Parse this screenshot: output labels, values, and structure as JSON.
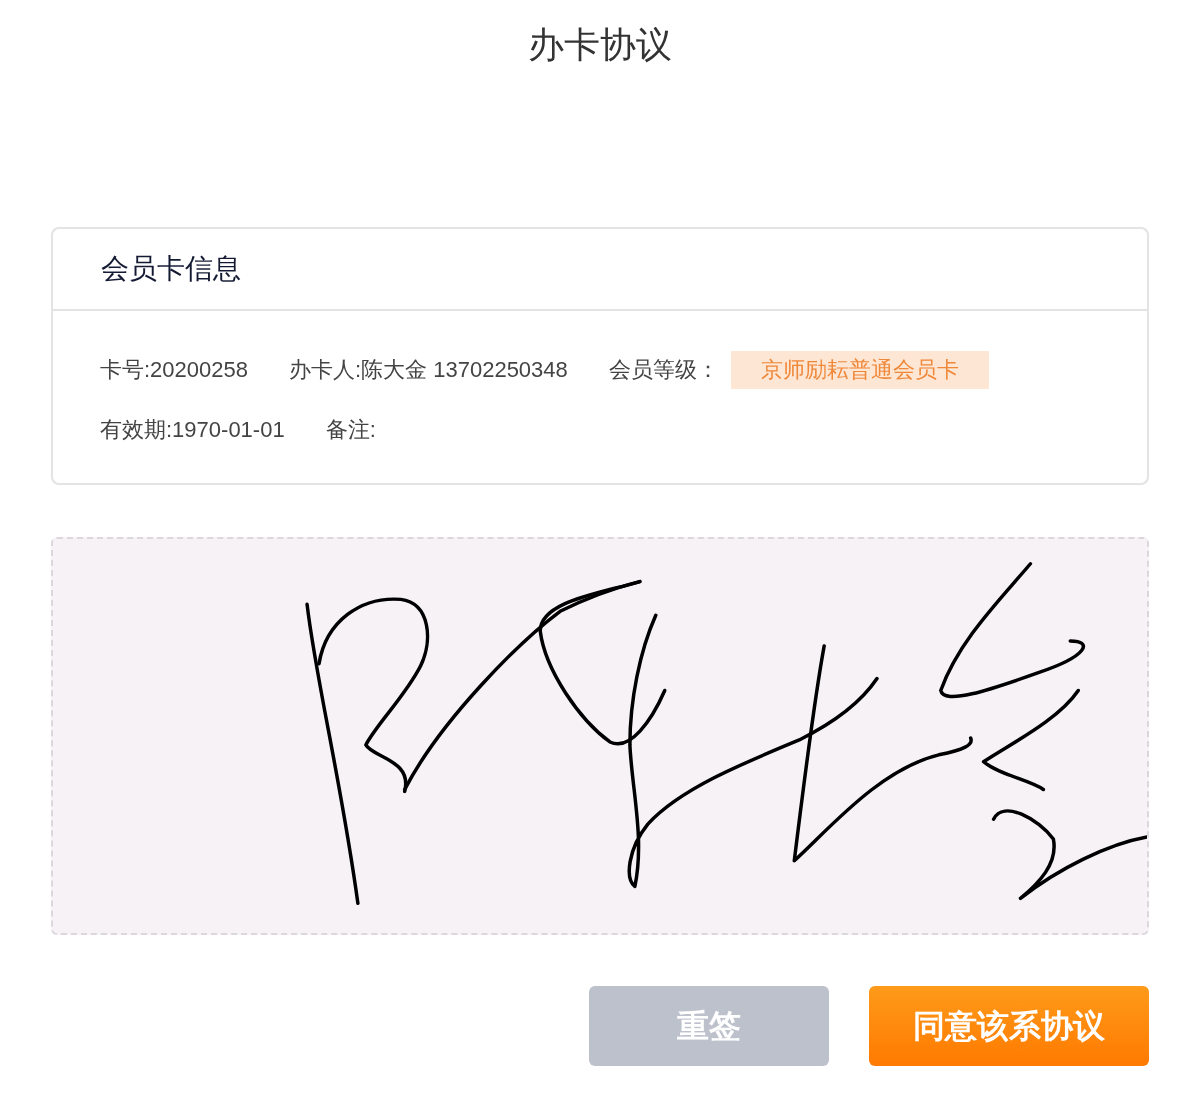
{
  "title": "办卡协议",
  "card": {
    "title": "会员卡信息",
    "rows": [
      [
        {
          "kind": "text",
          "text": "卡号:20200258"
        },
        {
          "kind": "text",
          "text": "办卡人:陈大金 13702250348"
        },
        {
          "kind": "label",
          "text": "会员等级："
        },
        {
          "kind": "tag",
          "text": "京师励耘普通会员卡"
        }
      ],
      [
        {
          "kind": "text",
          "text": "有效期:1970-01-01"
        },
        {
          "kind": "text",
          "text": "备注:"
        }
      ]
    ]
  },
  "signature_pad": {
    "signed": true
  },
  "buttons": [
    {
      "label": "重签",
      "kind": "secondary"
    },
    {
      "label": "同意该系协议",
      "kind": "primary"
    }
  ]
}
